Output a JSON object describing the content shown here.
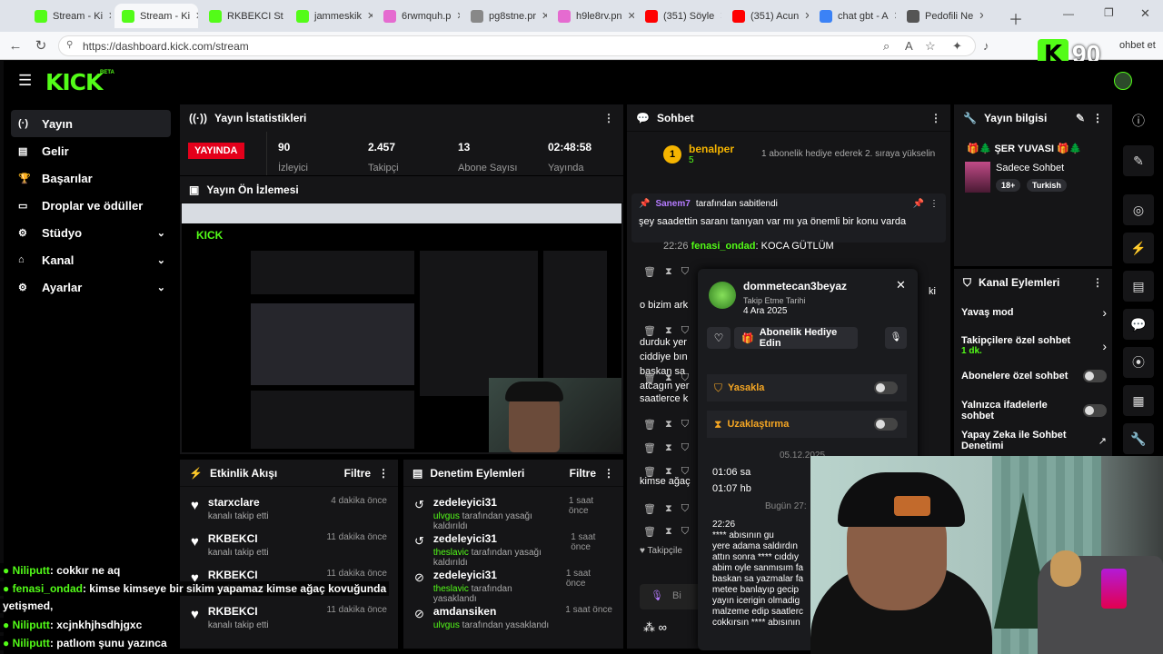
{
  "browser": {
    "tabs": [
      {
        "label": "Stream - Ki",
        "color": "#53fc18"
      },
      {
        "label": "Stream - Ki",
        "color": "#53fc18"
      },
      {
        "label": "RKBEKCI St",
        "color": "#53fc18"
      },
      {
        "label": "jammeskik",
        "color": "#53fc18"
      },
      {
        "label": "6rwmquh.p",
        "color": "#e56bd0"
      },
      {
        "label": "pg8stne.pr",
        "color": "#888888"
      },
      {
        "label": "h9le8rv.pn",
        "color": "#e56bd0"
      },
      {
        "label": "(351) Söyle",
        "color": "#ff0000"
      },
      {
        "label": "(351) Acun",
        "color": "#ff0000"
      },
      {
        "label": "chat gbt - A",
        "color": "#3b82f6"
      },
      {
        "label": "Pedofili Ne",
        "color": "#555555"
      }
    ],
    "url": "https://dashboard.kick.com/stream",
    "right_label": "ohbet et"
  },
  "brand": {
    "logo": "KICK",
    "beta": "BETA",
    "badge_count": "90",
    "accent": "#53fc18"
  },
  "sidebar": {
    "items": [
      {
        "label": "Yayın",
        "icon": "broadcast-icon"
      },
      {
        "label": "Gelir",
        "icon": "wallet-icon"
      },
      {
        "label": "Başarılar",
        "icon": "trophy-icon"
      },
      {
        "label": "Droplar ve ödüller",
        "icon": "gift-icon"
      },
      {
        "label": "Stüdyo",
        "icon": "gear-icon",
        "chevron": "⌄"
      },
      {
        "label": "Kanal",
        "icon": "home-icon",
        "chevron": "⌄"
      },
      {
        "label": "Ayarlar",
        "icon": "settings-icon",
        "chevron": "⌄"
      }
    ]
  },
  "stats": {
    "title": "Yayın İstatistikleri",
    "live_badge": "YAYINDA",
    "values": [
      {
        "value": "90",
        "label": "İzleyici"
      },
      {
        "value": "2.457",
        "label": "Takipçi"
      },
      {
        "value": "13",
        "label": "Abone Sayısı"
      },
      {
        "value": "02:48:58",
        "label": "Yayında"
      }
    ]
  },
  "preview": {
    "title": "Yayın Ön İzlemesi"
  },
  "activity": {
    "title": "Etkinlik Akışı",
    "filter": "Filtre",
    "rows": [
      {
        "name": "starxclare",
        "sub": "kanalı takip etti",
        "time": "4 dakika önce"
      },
      {
        "name": "RKBEKCI",
        "sub": "kanalı takip etti",
        "time": "11 dakika önce"
      },
      {
        "name": "RKBEKCI",
        "sub": "kanalı takip etti",
        "time": "11 dakika önce"
      },
      {
        "name": "RKBEKCI",
        "sub": "kanalı takip etti",
        "time": "11 dakika önce"
      }
    ]
  },
  "moderation": {
    "title": "Denetim Eylemleri",
    "filter": "Filtre",
    "rows": [
      {
        "name": "zedeleyici31",
        "by": "ulvgus",
        "action": "tarafından yasağı kaldırıldı",
        "time": "1 saat önce"
      },
      {
        "name": "zedeleyici31",
        "by": "theslavic",
        "action": "tarafından yasağı kaldırıldı",
        "time": "1 saat önce"
      },
      {
        "name": "zedeleyici31",
        "by": "theslavic",
        "action": "tarafından yasaklandı",
        "time": "1 saat önce"
      },
      {
        "name": "amdansiken",
        "by": "ulvgus",
        "action": "tarafından yasaklandı",
        "time": "1 saat önce"
      }
    ]
  },
  "chat": {
    "title": "Sohbet",
    "leader": {
      "rank": "1",
      "name": "benalper",
      "count": "5"
    },
    "goal": "1 abonelik hediye ederek 2. sıraya yükselin",
    "pinned": {
      "user": "Sanem7",
      "by_text": "tarafından sabitlendi",
      "message": "şey saadettin saranı tanıyan var mı ya önemli bir konu varda"
    },
    "line1": {
      "time": "22:26",
      "user": "fenasi_ondad",
      "text": "KOCA GÜTLÜM"
    },
    "fragments": [
      "o bizim ark",
      "durduk yer",
      "ciddiye bın",
      "baskan sa",
      "atcagın yer",
      "saatlerce k",
      "kimse ağaç"
    ],
    "side_text": "ki",
    "followers_label": "Takipçile",
    "input_placeholder": "Bi"
  },
  "user_card": {
    "username": "dommetecan3beyaz",
    "follow_label": "Takip Etme Tarihi",
    "follow_date": "4 Ara 2025",
    "gift_button": "Abonelik Hediye Edin",
    "ban_label": "Yasakla",
    "timeout_label": "Uzaklaştırma",
    "date1": "05.12.2025",
    "m1_time": "01:06",
    "m1_text": "sa",
    "m2_time": "01:07",
    "m2_text": "hb",
    "date2": "Bugün 27:",
    "long_time": "22:26",
    "long_lines": [
      "**** abısının gu",
      "yere adama saldırdın",
      "attın sonra **** cıddıy",
      "abim oyle sanmısım fa",
      "baskan sa yazmalar fa",
      "metee banlayıp gecip",
      "yayın icerigin olmadig",
      "malzeme edip saatlerc",
      "cokkırsın **** abısının"
    ]
  },
  "stream_info": {
    "title": "Yayın bilgisi",
    "name": "ŞER YUVASI",
    "category": "Sadece Sohbet",
    "tags": [
      "18+",
      "Turkish"
    ]
  },
  "channel_actions": {
    "title": "Kanal Eylemleri",
    "rows": [
      {
        "label": "Yavaş mod",
        "control": "chevron"
      },
      {
        "label": "Takipçilere özel sohbet",
        "sub": "1 dk.",
        "control": "chevron"
      },
      {
        "label": "Abonelere özel sohbet",
        "control": "toggle"
      },
      {
        "label": "Yalnızca ifadelerle sohbet",
        "control": "toggle"
      },
      {
        "label": "Yapay Zeka ile Sohbet Denetimi",
        "control": "external"
      }
    ]
  },
  "overlay_chat": [
    {
      "user": "Niliputt",
      "text": ": cokkır ne aq"
    },
    {
      "user": "fenasi_ondad",
      "text": ": kimse kimseye bir sikim yapamaz kimse ağaç kovuğunda"
    },
    {
      "user": "",
      "text": "yetişmed,"
    },
    {
      "user": "Niliputt",
      "text": ": xcjnkhjhsdhjgxc"
    },
    {
      "user": "Niliputt",
      "text": ": patlıom şunu yazınca"
    }
  ]
}
